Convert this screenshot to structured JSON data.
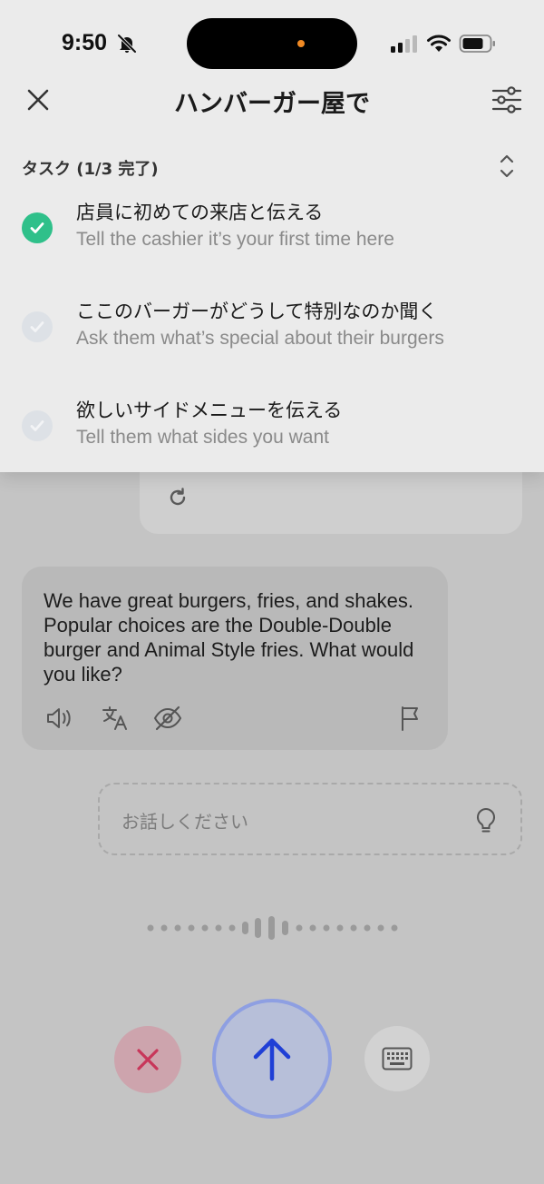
{
  "status_bar": {
    "time": "9:50",
    "icons": [
      "bell-slash-icon",
      "signal-icon",
      "wifi-icon",
      "battery-icon"
    ]
  },
  "header": {
    "title": "ハンバーガー屋で",
    "close_icon": "close-icon",
    "settings_icon": "sliders-icon"
  },
  "tasks": {
    "heading": "タスク (1/3 完了)",
    "items": [
      {
        "jp": "店員に初めての来店と伝える",
        "en": "Tell the cashier it’s your first time here",
        "done": true
      },
      {
        "jp": "ここのバーガーがどうして特別なのか聞く",
        "en": "Ask them what’s special about their burgers",
        "done": false
      },
      {
        "jp": "欲しいサイドメニューを伝える",
        "en": "Tell them what sides you want",
        "done": false
      }
    ]
  },
  "chat": {
    "ai_message": "We have great burgers, fries, and shakes. Popular choices are the Double-Double burger and Animal Style fries. What would you like?",
    "ai_actions": [
      "speaker-icon",
      "translate-icon",
      "eye-off-icon",
      "flag-icon"
    ],
    "user_actions": [
      "retry-icon"
    ]
  },
  "input": {
    "placeholder": "お話しください",
    "hint_icon": "lightbulb-icon"
  },
  "controls": {
    "cancel_icon": "x-icon",
    "send_icon": "arrow-up-icon",
    "keyboard_icon": "keyboard-icon"
  },
  "colors": {
    "done_green": "#2fc08a",
    "send_blue": "#1f3fd6",
    "cancel_red": "#c8365a"
  }
}
